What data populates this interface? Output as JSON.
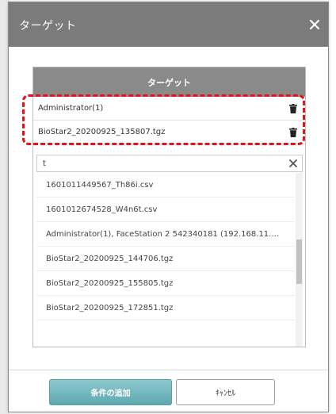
{
  "dialog": {
    "title": "ターゲット",
    "close_icon": "close-icon"
  },
  "panel": {
    "header": "ターゲット",
    "selected": [
      {
        "label": "Administrator(1)",
        "icon": "trash-icon"
      },
      {
        "label": "BioStar2_20200925_135807.tgz",
        "icon": "trash-icon"
      }
    ],
    "highlight_color": "#e3131a"
  },
  "search": {
    "value": "t",
    "clear_icon": "clear-icon"
  },
  "results": [
    "1601011449567_Th86i.csv",
    "1601012674528_W4n6t.csv",
    "Administrator(1), FaceStation 2 542340181 (192.168.11.…",
    "BioStar2_20200925_144706.tgz",
    "BioStar2_20200925_155805.tgz",
    "BioStar2_20200925_172851.tgz"
  ],
  "buttons": {
    "add": "条件の追加",
    "cancel": "ｷｬﾝｾﾙ"
  },
  "colors": {
    "titlebar": "#7b7b7b",
    "header": "#8a8a8a",
    "add_button": "#6fb3ba"
  }
}
